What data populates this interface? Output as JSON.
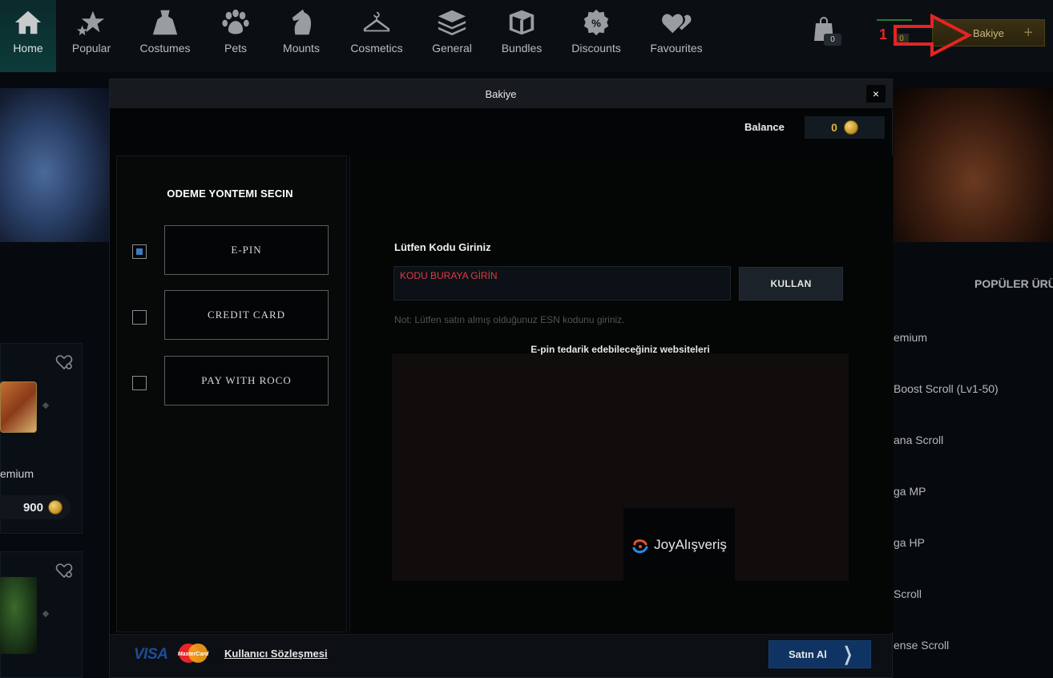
{
  "nav": {
    "items": [
      {
        "label": "Home",
        "icon": "home-icon"
      },
      {
        "label": "Popular",
        "icon": "stars-icon"
      },
      {
        "label": "Costumes",
        "icon": "dress-icon"
      },
      {
        "label": "Pets",
        "icon": "paw-icon"
      },
      {
        "label": "Mounts",
        "icon": "horse-icon"
      },
      {
        "label": "Cosmetics",
        "icon": "hanger-icon"
      },
      {
        "label": "General",
        "icon": "layers-icon"
      },
      {
        "label": "Bundles",
        "icon": "box-icon"
      },
      {
        "label": "Discounts",
        "icon": "discount-icon"
      },
      {
        "label": "Favourites",
        "icon": "hearts-icon"
      }
    ],
    "cart_count": "0",
    "annotation_number": "1",
    "annotation_count": "0",
    "bakiye_label": "Bakiye",
    "bakiye_plus": "+"
  },
  "background": {
    "item_name": "emium",
    "item_price": "900",
    "popular_title": "POPÜLER ÜRÜ",
    "popular_items": [
      "emium",
      "Boost Scroll (Lv1-50)",
      "ana Scroll",
      "ga MP",
      "ga HP",
      "Scroll",
      "ense Scroll"
    ]
  },
  "modal": {
    "title": "Bakiye",
    "close": "×",
    "balance_label": "Balance",
    "balance_value": "0",
    "method_title": "ODEME YONTEMI SECIN",
    "methods": [
      {
        "label": "E-PIN",
        "checked": true
      },
      {
        "label": "CREDIT CARD",
        "checked": false
      },
      {
        "label": "PAY WITH ROCO",
        "checked": false
      }
    ],
    "code_title": "Lütfen Kodu Giriniz",
    "code_placeholder": "KODU BURAYA GİRİN",
    "use_button": "KULLAN",
    "note": "Not: Lütfen satın almış olduğunuz ESN kodunu giriniz.",
    "sites_title": "E-pin tedarik edebileceğiniz websiteleri",
    "site_name": "JoyAlışveriş",
    "footer": {
      "visa": "VISA",
      "mastercard": "MasterCard",
      "agreement": "Kullanıcı Sözleşmesi",
      "buy": "Satın Al",
      "buy_chevron": "❯"
    }
  },
  "colors": {
    "accent_blue": "#0f3363",
    "coin_gold": "#e3b436",
    "placeholder_red": "#e53940",
    "annotation_red": "#e52424"
  }
}
